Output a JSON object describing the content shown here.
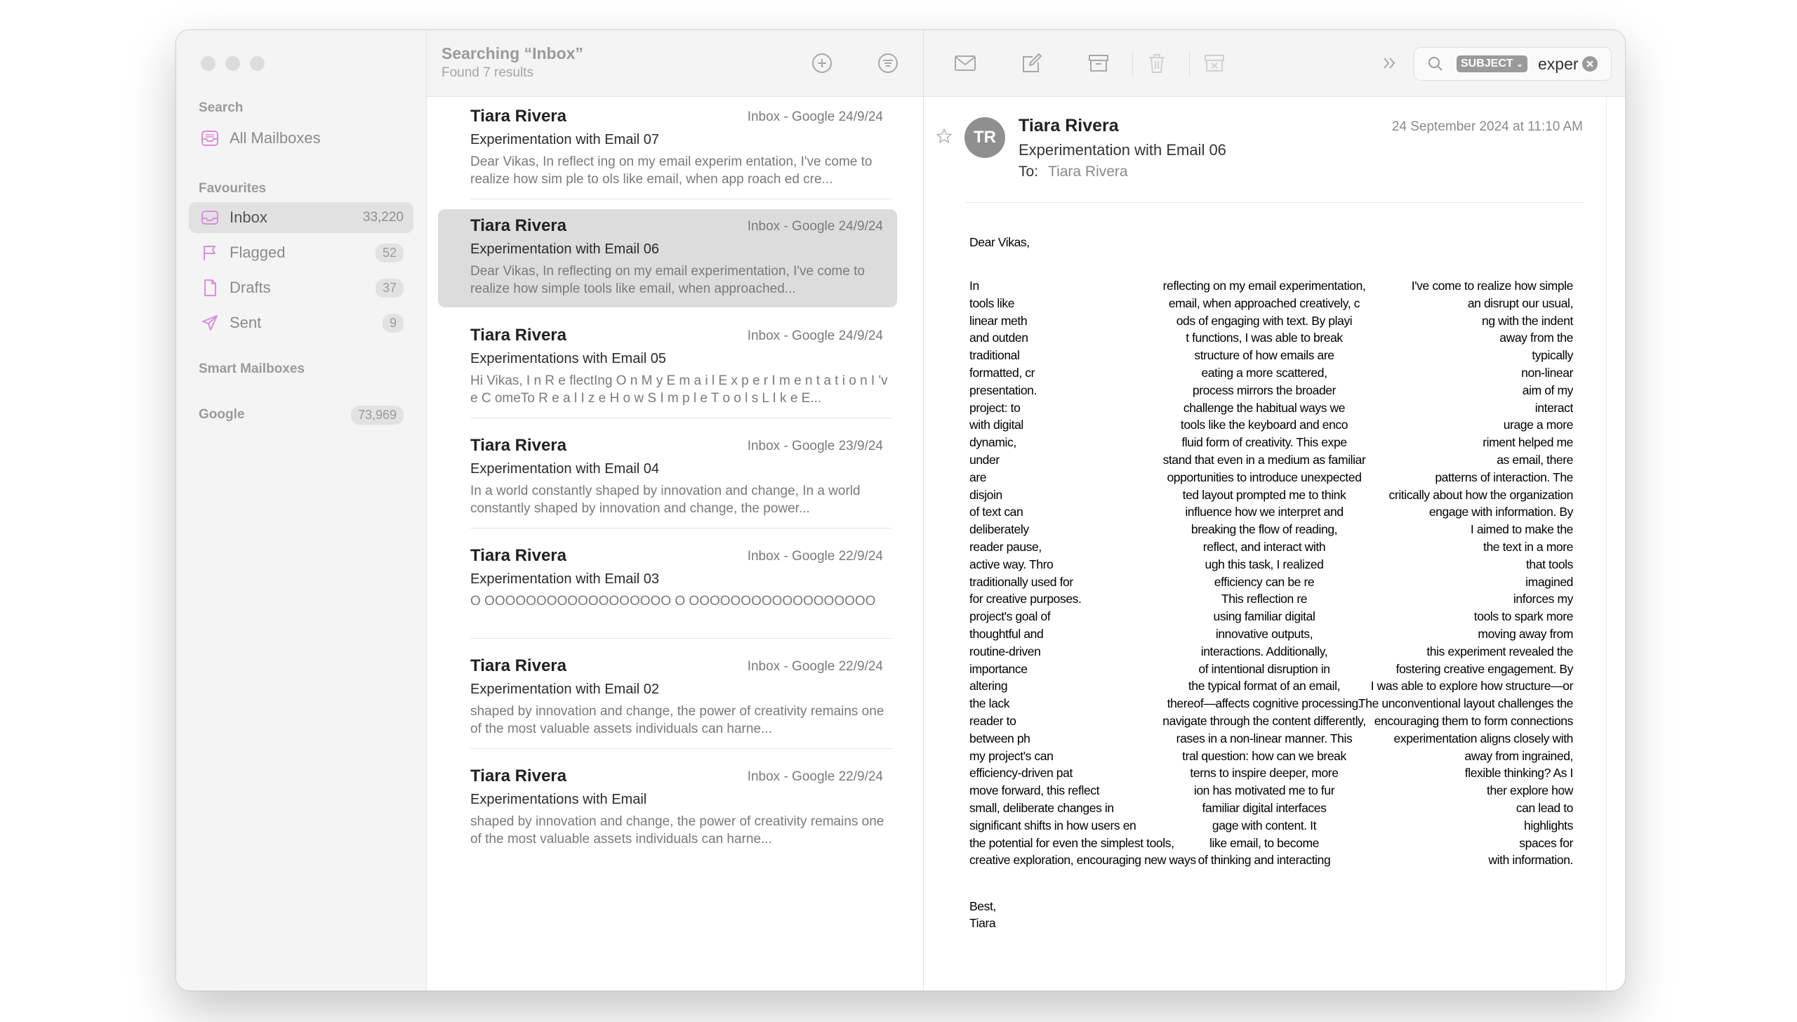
{
  "sidebar": {
    "sections": {
      "search": "Search",
      "favourites": "Favourites",
      "smart": "Smart Mailboxes",
      "google": "Google"
    },
    "all_mailboxes": "All Mailboxes",
    "items": [
      {
        "label": "Inbox",
        "count": "33,220"
      },
      {
        "label": "Flagged",
        "count": "52"
      },
      {
        "label": "Drafts",
        "count": "37"
      },
      {
        "label": "Sent",
        "count": "9"
      }
    ],
    "google_count": "73,969"
  },
  "list": {
    "title": "Searching “Inbox”",
    "subtitle": "Found 7 results",
    "messages": [
      {
        "sender": "Tiara Rivera",
        "meta": "Inbox - Google   24/9/24",
        "subject": "Experimentation with Email 07",
        "preview": "Dear Vikas, In reflect ing on my email experim entation, I've come to realize how sim ple to ols like email, when app roach ed cre..."
      },
      {
        "sender": "Tiara Rivera",
        "meta": "Inbox - Google   24/9/24",
        "subject": "Experimentation with Email 06",
        "preview": "Dear Vikas, In reflecting on my email experimentation, I've come to realize how simple tools like email, when approached..."
      },
      {
        "sender": "Tiara Rivera",
        "meta": "Inbox - Google   24/9/24",
        "subject": "Experimentations with Email 05",
        "preview": "Hi Vikas, I n R e flectIng O n M y E m a i l E x p e r I m e n t a t i o n I 'v e C omeTo R e a l I z e H o w S I m p l e T o o l s L I k e E..."
      },
      {
        "sender": "Tiara Rivera",
        "meta": "Inbox - Google   23/9/24",
        "subject": "Experimentation with Email 04",
        "preview": "In a world constantly shaped by innovation and change, In a world constantly shaped by innovation and change, the power..."
      },
      {
        "sender": "Tiara Rivera",
        "meta": "Inbox - Google   22/9/24",
        "subject": "Experimentation with Email 03",
        "preview": "O OOOOOOOOOOOOOOOOOO O OOOOOOOOOOOOOOOOOO"
      },
      {
        "sender": "Tiara Rivera",
        "meta": "Inbox - Google   22/9/24",
        "subject": "Experimentation with Email 02",
        "preview": "shaped by innovation and change, the power of creativity remains one of the most valuable assets individuals can harne..."
      },
      {
        "sender": "Tiara Rivera",
        "meta": "Inbox - Google   22/9/24",
        "subject": "Experimentations with Email",
        "preview": "shaped by innovation and change, the power of creativity remains one of the most valuable assets individuals can harne..."
      }
    ]
  },
  "search": {
    "token": "SUBJECT",
    "query": "exper"
  },
  "reader": {
    "avatar": "TR",
    "from": "Tiara Rivera",
    "subject": "Experimentation with Email 06",
    "to_label": "To:",
    "to_name": "Tiara Rivera",
    "date": "24 September 2024 at 11:10 AM",
    "greeting": "Dear Vikas,",
    "lines": [
      [
        "In",
        "reflecting on my email experimentation,",
        "I've come to realize how simple"
      ],
      [
        "tools like",
        "email, when approached creatively, c",
        "an disrupt our usual,"
      ],
      [
        "linear meth",
        "ods of engaging with text. By playi",
        "ng with the indent"
      ],
      [
        "and outden",
        "t functions, I was able to break",
        "away from the"
      ],
      [
        "traditional",
        "structure of how emails are",
        "typically"
      ],
      [
        "formatted, cr",
        "eating a more scattered,",
        "non-linear"
      ],
      [
        "presentation.",
        "process mirrors the broader",
        "aim of my"
      ],
      [
        "project: to",
        "challenge the habitual ways we",
        "interact"
      ],
      [
        "with digital",
        "tools like the keyboard and enco",
        "urage a more"
      ],
      [
        "dynamic,",
        "fluid form of creativity. This expe",
        "riment helped me"
      ],
      [
        "under",
        "stand that even in a medium as familiar",
        "as email, there"
      ],
      [
        "are",
        "opportunities to introduce unexpected",
        "patterns of interaction. The"
      ],
      [
        "disjoin",
        "ted layout prompted me to think",
        "critically about how the organization"
      ],
      [
        "of text can",
        "influence how we interpret and",
        "engage with information. By"
      ],
      [
        "deliberately",
        "breaking the flow of reading,",
        "I aimed to make the"
      ],
      [
        "reader pause,",
        "reflect, and interact with",
        "the text in a more"
      ],
      [
        "active way. Thro",
        "ugh this task, I realized",
        "that tools"
      ],
      [
        "traditionally used for",
        "efficiency can be re",
        "imagined"
      ],
      [
        "for creative purposes.",
        "This reflection re",
        "inforces my"
      ],
      [
        "project's goal of",
        "using familiar digital",
        "tools to spark more"
      ],
      [
        "thoughtful and",
        "innovative outputs,",
        "moving away from"
      ],
      [
        "routine-driven",
        "interactions. Additionally,",
        "this experiment revealed the"
      ],
      [
        "importance",
        "of intentional disruption in",
        "fostering creative engagement. By"
      ],
      [
        "altering",
        "the typical format of an email,",
        "I was able to explore how structure—or"
      ],
      [
        "the lack",
        "thereof—affects cognitive processing.",
        "The unconventional layout challenges the"
      ],
      [
        "reader to",
        "navigate through the content differently,",
        "encouraging them to form connections"
      ],
      [
        "between ph",
        "rases in a non-linear manner. This",
        "experimentation aligns closely with"
      ],
      [
        "my project's can",
        "tral question: how can we break",
        "away from ingrained,"
      ],
      [
        "efficiency-driven pat",
        "terns to inspire deeper, more",
        "flexible thinking? As I"
      ],
      [
        "move forward, this reflect",
        "ion has motivated me to fur",
        "ther explore how"
      ],
      [
        "small, deliberate changes in",
        "familiar digital interfaces",
        "can lead to"
      ],
      [
        "significant shifts in how users en",
        "gage with content. It",
        "highlights"
      ],
      [
        "the potential for even the simplest tools,",
        "like email, to become",
        "spaces for"
      ],
      [
        "creative exploration, encouraging new ways",
        "of thinking and interacting",
        "with information."
      ]
    ],
    "signoff": "Best,",
    "signature": "Tiara"
  }
}
